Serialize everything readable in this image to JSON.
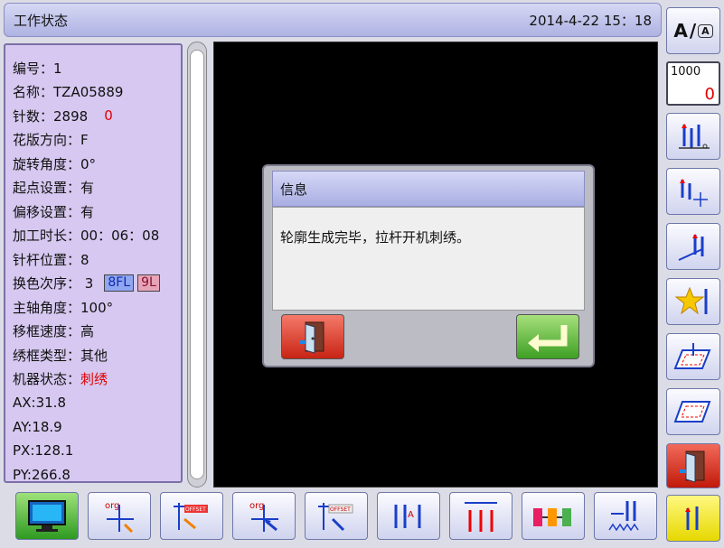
{
  "header": {
    "title": "工作状态",
    "datetime": "2014-4-22  15：18"
  },
  "info": {
    "rows": [
      {
        "label": "编号：1"
      },
      {
        "label": "名称：TZA05889"
      },
      {
        "label": "针数：2898",
        "extra": "0"
      },
      {
        "label": "花版方向：F"
      },
      {
        "label": "旋转角度：0°"
      },
      {
        "label": "起点设置：有"
      },
      {
        "label": "偏移设置：有"
      },
      {
        "label": "加工时长：00：06：08"
      },
      {
        "label": "针杆位置：8"
      },
      {
        "label": "换色次序： 3",
        "tag1": "8FL",
        "tag2": "9L"
      },
      {
        "label": "主轴角度：100°"
      },
      {
        "label": "移框速度：高"
      },
      {
        "label": "绣框类型：其他"
      },
      {
        "label": "机器状态：",
        "status": "刺绣"
      },
      {
        "label": "AX:31.8"
      },
      {
        "label": "AY:18.9"
      },
      {
        "label": "PX:128.1"
      },
      {
        "label": "PY:266.8"
      }
    ]
  },
  "dialog": {
    "title": "信息",
    "message": "轮廓生成完毕，拉杆开机刺绣。"
  },
  "right_toolbar": {
    "lang_big": "A",
    "lang_small": "A",
    "counter_top": "1000",
    "counter_value": "0"
  },
  "bottom_toolbar": {
    "org_label": "org",
    "offset_label": "OFFSET"
  },
  "colors": {
    "accent_red": "#e00000",
    "panel": "#d6c8f0",
    "title": "#aeb2e2"
  }
}
